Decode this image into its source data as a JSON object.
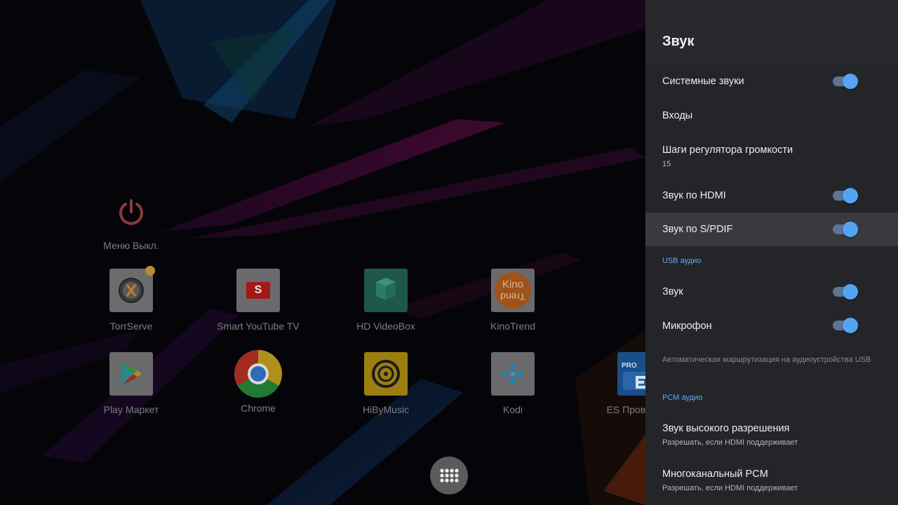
{
  "launcher": {
    "power_app": {
      "label": "Меню Выкл."
    },
    "apps_row1": [
      {
        "label": "TorrServe"
      },
      {
        "label": "Smart YouTube TV"
      },
      {
        "label": "HD VideoBox"
      },
      {
        "label": "KinoTrend"
      }
    ],
    "apps_row2": [
      {
        "label": "Play Маркет"
      },
      {
        "label": "Chrome"
      },
      {
        "label": "HiByMusic"
      },
      {
        "label": "Kodi"
      },
      {
        "label": "ES Проводник"
      }
    ],
    "tile_text": {
      "youtube": "S",
      "es_pro": "PRO",
      "kino_top": "Kino",
      "kino_bottom": "Trend"
    }
  },
  "settings": {
    "title": "Звук",
    "items": [
      {
        "title": "Системные звуки",
        "toggle": true
      },
      {
        "title": "Входы"
      },
      {
        "title": "Шаги регулятора громкости",
        "summary": "15"
      },
      {
        "title": "Звук по HDMI",
        "toggle": true
      },
      {
        "title": "Звук по S/PDIF",
        "toggle": true,
        "focused": true
      }
    ],
    "usb_section": "USB аудио",
    "usb_items": [
      {
        "title": "Звук",
        "toggle": true
      },
      {
        "title": "Микрофон",
        "toggle": true
      }
    ],
    "usb_note": "Автоматическая маршрутизация на аудиоустройства USB",
    "pcm_section": "PCM аудио",
    "pcm_items": [
      {
        "title": "Звук высокого разрешения",
        "summary": "Разрешать, если HDMI поддерживает"
      },
      {
        "title": "Многоканальный PCM",
        "summary": "Разрешать, если HDMI поддерживает"
      }
    ]
  },
  "colors": {
    "accent": "#55a4f4",
    "panel_bg": "#242529",
    "focused_row": "#393a3e"
  }
}
